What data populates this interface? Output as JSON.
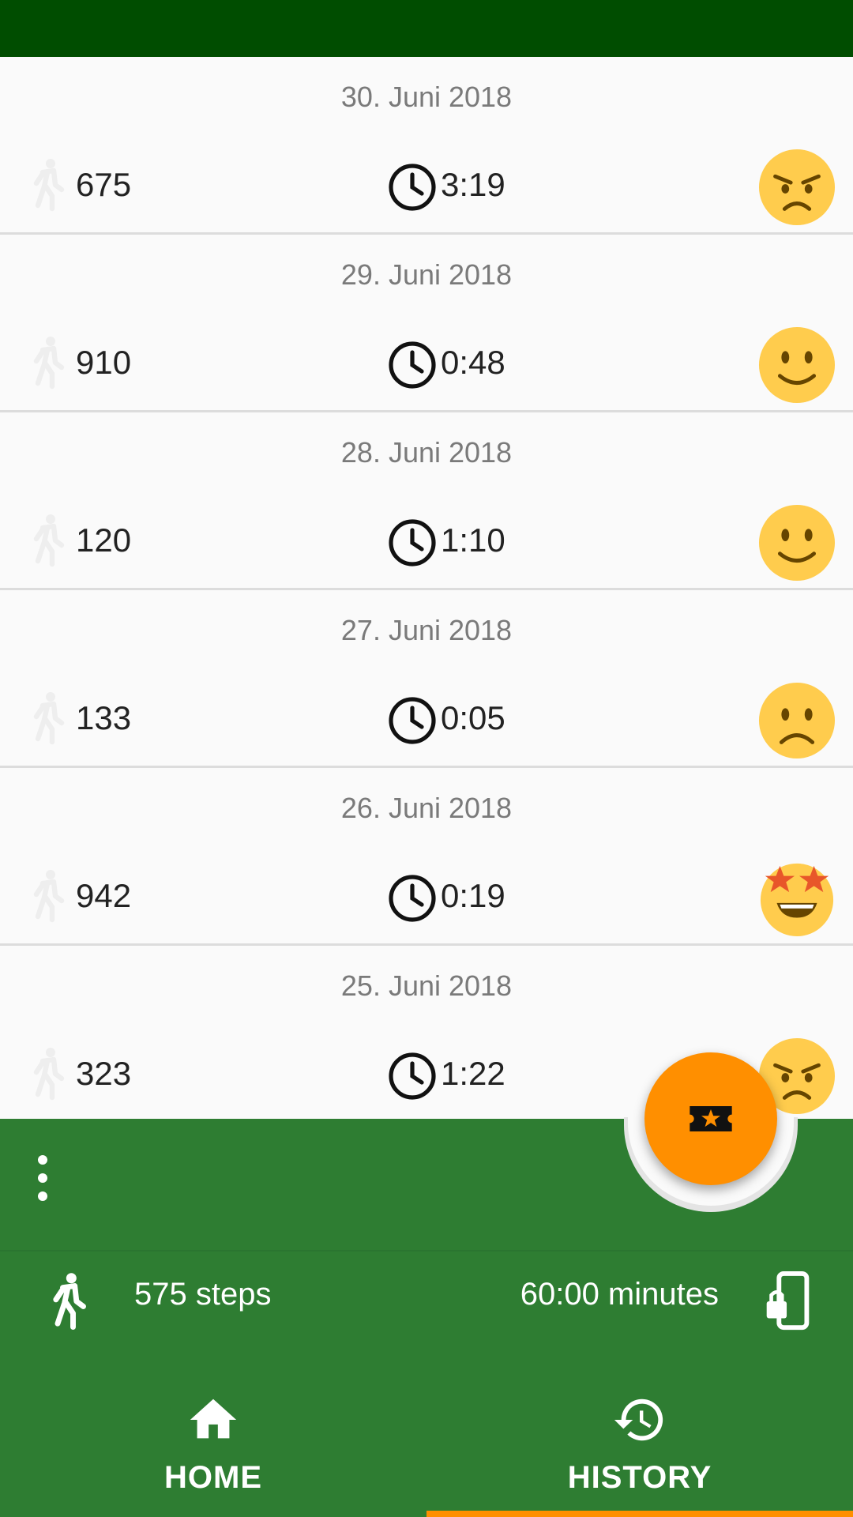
{
  "entries": [
    {
      "date": "30. Juni 2018",
      "steps": "675",
      "duration": "3:19",
      "mood": "angry-face-icon"
    },
    {
      "date": "29. Juni 2018",
      "steps": "910",
      "duration": "0:48",
      "mood": "smiling-face-icon"
    },
    {
      "date": "28. Juni 2018",
      "steps": "120",
      "duration": "1:10",
      "mood": "smiling-face-icon"
    },
    {
      "date": "27. Juni 2018",
      "steps": "133",
      "duration": "0:05",
      "mood": "frowning-face-icon"
    },
    {
      "date": "26. Juni 2018",
      "steps": "942",
      "duration": "0:19",
      "mood": "star-struck-face-icon"
    },
    {
      "date": "25. Juni 2018",
      "steps": "323",
      "duration": "1:22",
      "mood": "angry-face-icon"
    }
  ],
  "summary": {
    "steps": "575 steps",
    "minutes": "60:00 minutes"
  },
  "nav": {
    "home": "HOME",
    "history": "HISTORY",
    "active": "history"
  },
  "colors": {
    "status_bar": "#004d00",
    "bottom_bar": "#2e7d32",
    "accent": "#ff8f00",
    "emoji": "#ffcc4d"
  },
  "fab_icon": "ticket-star-icon"
}
